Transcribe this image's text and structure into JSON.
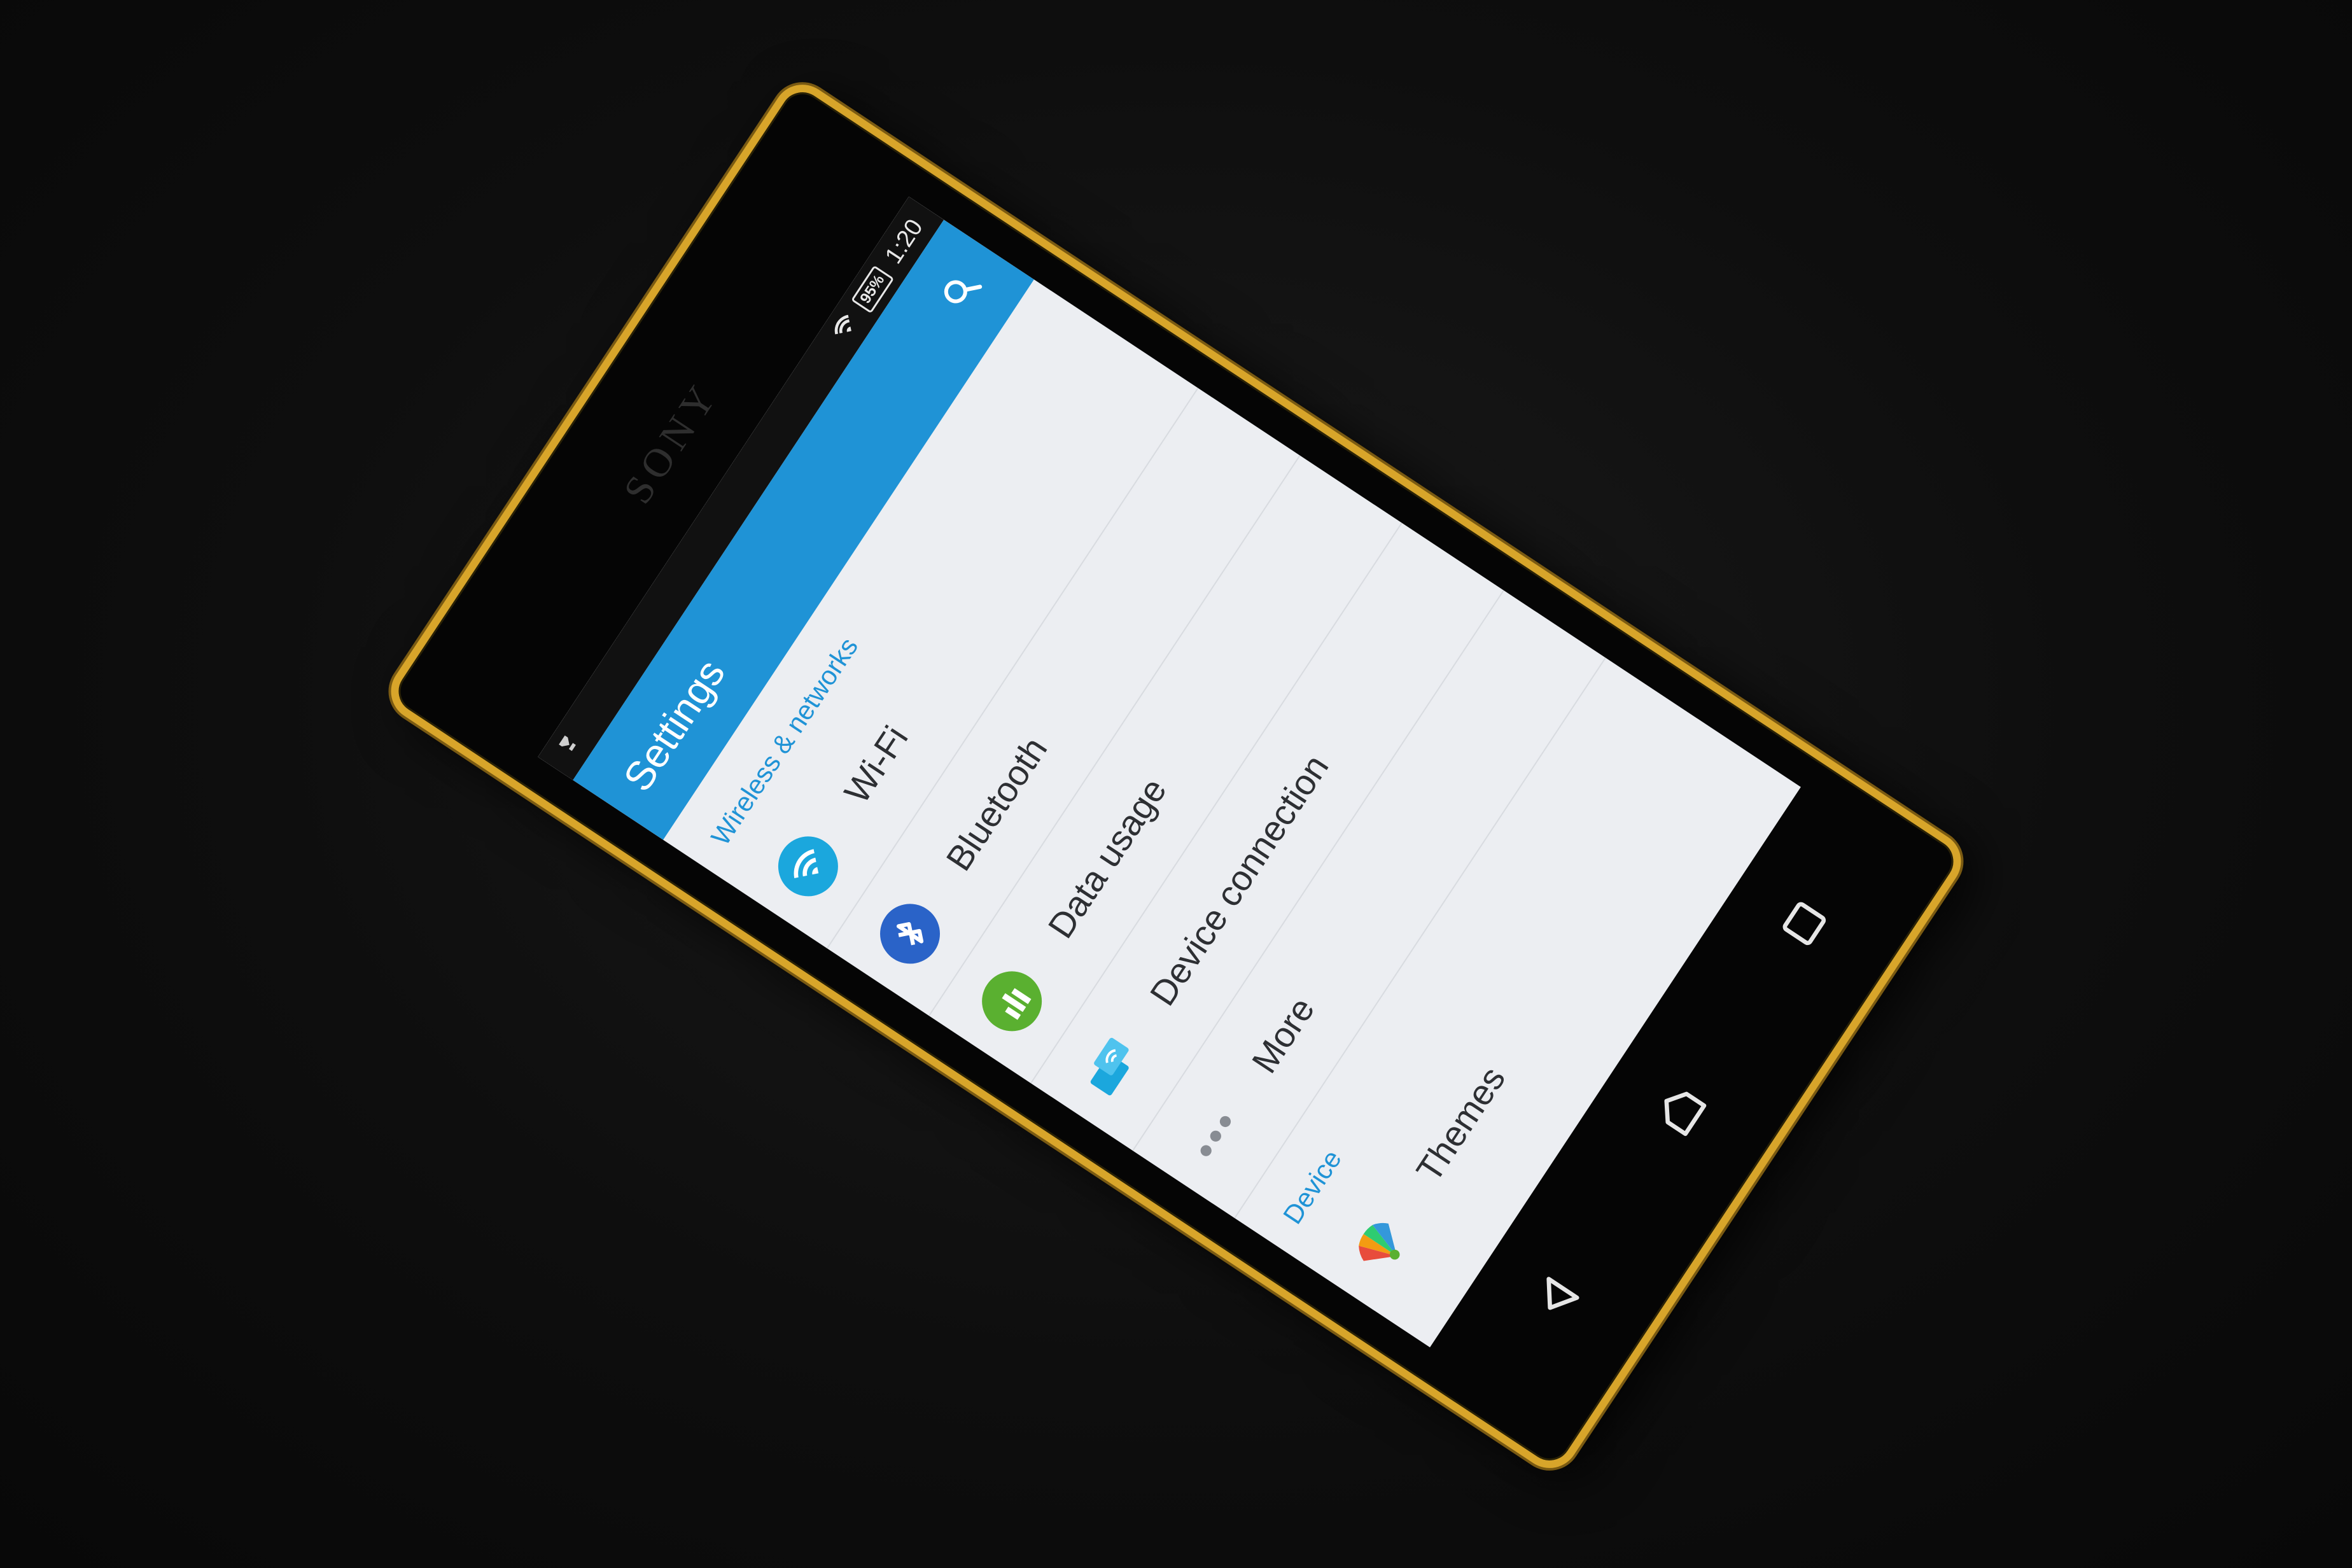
{
  "device": {
    "brand": "SONY"
  },
  "status_bar": {
    "battery": "95%",
    "time": "1:20"
  },
  "app_bar": {
    "title": "Settings",
    "search_icon": "search-icon"
  },
  "sections": [
    {
      "header": "Wireless & networks",
      "items": [
        {
          "label": "Wi-Fi",
          "icon": "wifi-icon",
          "color": "#1ba7dd"
        },
        {
          "label": "Bluetooth",
          "icon": "bluetooth-icon",
          "color": "#2a63c8"
        },
        {
          "label": "Data usage",
          "icon": "data-usage-icon",
          "color": "#5ab030"
        },
        {
          "label": "Device connection",
          "icon": "device-connection-icon",
          "color": "#1ba7dd"
        },
        {
          "label": "More",
          "icon": "more-icon",
          "color": "#888c93"
        }
      ]
    },
    {
      "header": "Device",
      "items": [
        {
          "label": "Themes",
          "icon": "themes-icon",
          "color": "#e84c3c"
        }
      ]
    }
  ],
  "nav_bar": {
    "buttons": [
      "back-icon",
      "home-icon",
      "recents-icon"
    ]
  },
  "colors": {
    "accent": "#1f93d6",
    "frame": "#d8a52a",
    "screen_bg": "#eceef2"
  }
}
